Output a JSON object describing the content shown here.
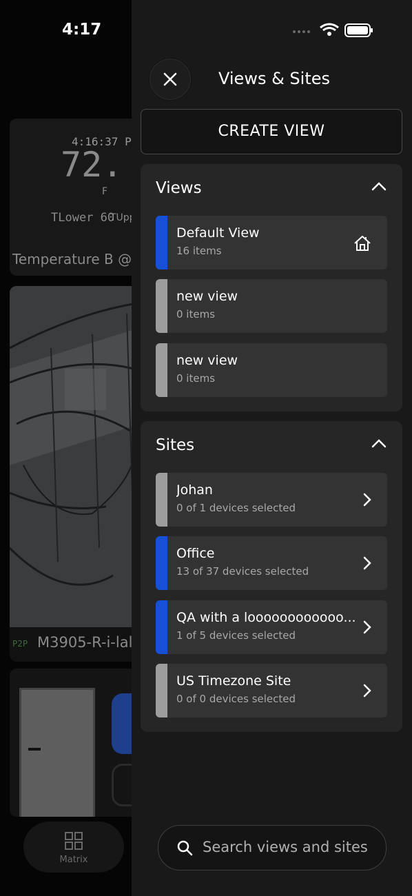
{
  "status_bar": {
    "time": "4:17"
  },
  "background": {
    "temperature_tile": {
      "time": "4:16:37 P",
      "value": "72.",
      "unit": "F",
      "lower_label": "TLower 60",
      "upper_label": "TUpp",
      "name": "Temperature B @"
    },
    "camera_tile": {
      "tag": "P2P",
      "name": "M3905-R-i-lal"
    },
    "bottom_nav": {
      "matrix_label": "Matrix"
    }
  },
  "drawer": {
    "title": "Views & Sites",
    "create_view_label": "CREATE VIEW",
    "views": {
      "title": "Views",
      "items": [
        {
          "title": "Default View",
          "subtitle": "16 items",
          "active": true,
          "icon": "home-icon"
        },
        {
          "title": "new view",
          "subtitle": "0 items",
          "active": false
        },
        {
          "title": "new view",
          "subtitle": "0 items",
          "active": false
        }
      ]
    },
    "sites": {
      "title": "Sites",
      "items": [
        {
          "title": "Johan",
          "subtitle": "0 of 1 devices selected",
          "active": false
        },
        {
          "title": "Office",
          "subtitle": "13 of 37 devices selected",
          "active": true
        },
        {
          "title": "QA with a loooooooooooo...",
          "subtitle": "1 of 5 devices selected",
          "active": true
        },
        {
          "title": "US Timezone Site",
          "subtitle": "0 of 0 devices selected",
          "active": false
        }
      ]
    },
    "search": {
      "placeholder": "Search views and sites"
    }
  },
  "colors": {
    "accent": "#1650d4",
    "inactive_bar": "#9d9d9d",
    "row_bg": "#333333",
    "section_bg": "#262626"
  }
}
